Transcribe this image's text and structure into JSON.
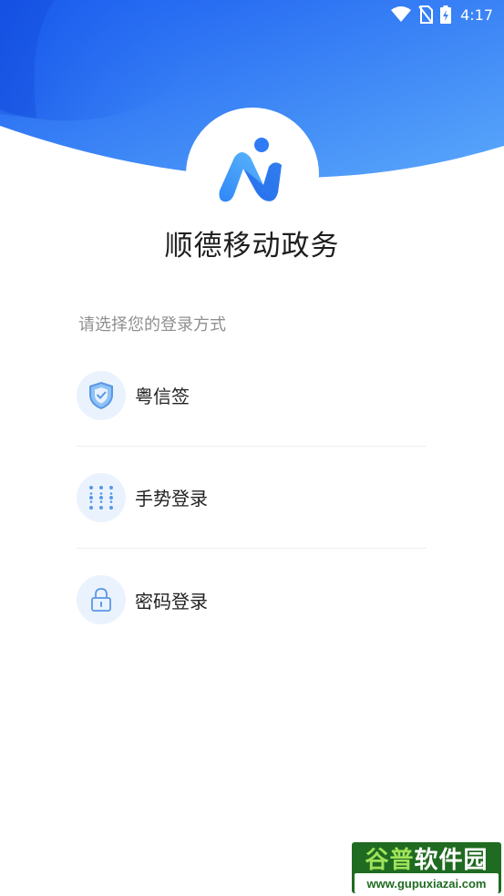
{
  "status_bar": {
    "time": "4:17",
    "icons": [
      "wifi-icon",
      "no-sim-icon",
      "battery-charging-icon"
    ]
  },
  "app": {
    "title": "顺德移动政务",
    "logo_icon": "app-logo-icon"
  },
  "login": {
    "prompt": "请选择您的登录方式",
    "methods": [
      {
        "label": "粤信签",
        "icon": "shield-check-icon"
      },
      {
        "label": "手势登录",
        "icon": "gesture-grid-icon"
      },
      {
        "label": "密码登录",
        "icon": "lock-icon"
      }
    ]
  },
  "watermark": {
    "title_a": "谷普",
    "title_b": "软件园",
    "url": "www.gupuxiazai.com"
  },
  "colors": {
    "brand_blue": "#2f7bf5",
    "header_gradient_start": "#1a5df0",
    "header_gradient_end": "#5aa8fb",
    "icon_bg": "#eaf3fd",
    "icon_stroke": "#5a97e6"
  }
}
